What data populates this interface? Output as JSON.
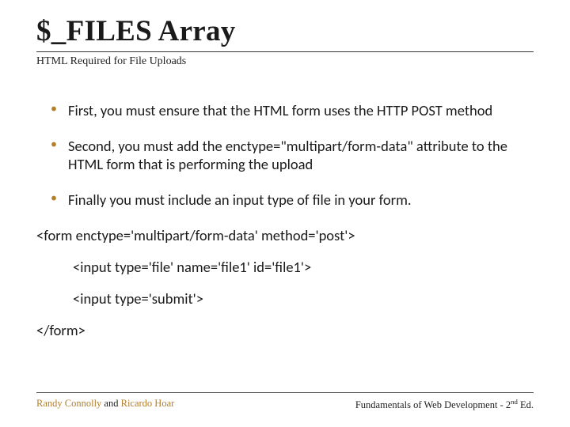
{
  "title": "$_FILES Array",
  "subtitle": "HTML Required for File Uploads",
  "bullets": [
    "First, you must ensure that the HTML form uses the HTTP POST  method",
    "Second, you must add the enctype=\"multipart/form-data\" attribute to the HTML form that is performing the upload",
    "Finally you must include an input type of file  in your form."
  ],
  "code": {
    "line1": "<form enctype='multipart/form-data' method='post'>",
    "line2": "<input type='file' name='file1' id='file1'>",
    "line3": "<input type='submit'>",
    "line4": "</form>"
  },
  "footer": {
    "author1": "Randy Connolly",
    "joiner": " and ",
    "author2": "Ricardo Hoar",
    "right_prefix": "Fundamentals of Web Development - 2",
    "right_suffix_sup": "nd",
    "right_tail": " Ed."
  }
}
